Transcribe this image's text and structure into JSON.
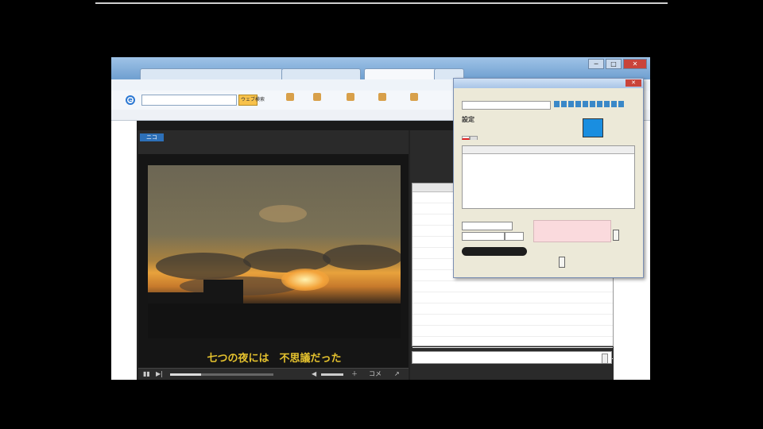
{
  "browser": {
    "tabs": [
      "",
      "",
      "",
      ""
    ],
    "window_buttons": [
      "─",
      "□",
      "✕"
    ],
    "search_button": "ウェブ検索",
    "toolbar_items": [
      "",
      "",
      "",
      "",
      ""
    ],
    "favbar_items": [
      "",
      "",
      "",
      ""
    ]
  },
  "player": {
    "badge": "ニコ",
    "title": "",
    "subtitle_line": "",
    "caption": "七つの夜には　不思議だった",
    "time": "",
    "controls": [
      "▮▮",
      "▶|",
      "◀",
      "＋",
      "コメ",
      "↗"
    ]
  },
  "comments": {
    "header_time": "",
    "rows": [
      {
        "t": "",
        "c": ""
      },
      {
        "t": "",
        "c": ""
      },
      {
        "t": "",
        "c": ""
      },
      {
        "t": "",
        "c": ""
      },
      {
        "t": "",
        "c": ""
      },
      {
        "t": "",
        "c": ""
      },
      {
        "t": "",
        "c": ""
      },
      {
        "t": "",
        "c": ""
      },
      {
        "t": "",
        "c": ""
      },
      {
        "t": "",
        "c": ""
      },
      {
        "t": "",
        "c": ""
      },
      {
        "t": "",
        "c": ""
      },
      {
        "t": "",
        "c": ""
      },
      {
        "t": "",
        "c": ""
      },
      {
        "t": "",
        "c": ""
      }
    ],
    "input_placeholder": "",
    "submit": ""
  },
  "popup": {
    "title": "",
    "close": "✕",
    "menu": "",
    "address": "",
    "section": "設定",
    "grid_header": [
      "",
      "",
      "",
      ""
    ],
    "grid_rows": [
      {
        "num": "",
        "name": "",
        "time": "",
        "text": ""
      },
      {
        "num": "",
        "name": "",
        "time": "",
        "text": ""
      },
      {
        "num": "",
        "name": "",
        "time": "",
        "text": ""
      },
      {
        "num": "",
        "name": "",
        "time": "",
        "text": ""
      },
      {
        "num": "",
        "name": "",
        "time": "",
        "text": ""
      },
      {
        "num": "",
        "name": "",
        "time": "",
        "text": ""
      },
      {
        "num": "",
        "name": "",
        "time": "",
        "text": ""
      }
    ],
    "sel1": "",
    "sel2": "",
    "button_right": "",
    "dark_bar": "",
    "hash": "",
    "small_btn": ""
  }
}
